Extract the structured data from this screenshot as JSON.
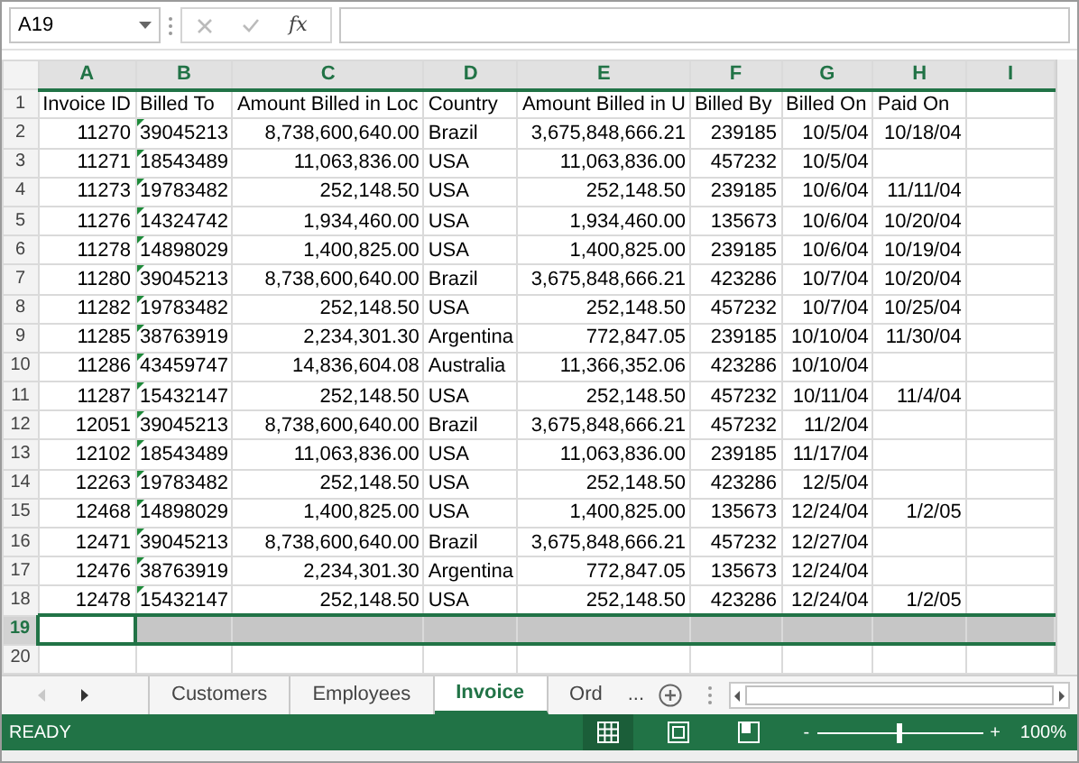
{
  "formula_bar": {
    "name_box": "A19",
    "function_label": "fx"
  },
  "columns": [
    {
      "letter": "A",
      "numeric": true,
      "selected": true
    },
    {
      "letter": "B",
      "numeric": false,
      "selected": true
    },
    {
      "letter": "C",
      "numeric": true,
      "selected": true
    },
    {
      "letter": "D",
      "numeric": false,
      "selected": true
    },
    {
      "letter": "E",
      "numeric": true,
      "selected": true
    },
    {
      "letter": "F",
      "numeric": true,
      "selected": true
    },
    {
      "letter": "G",
      "numeric": true,
      "selected": true
    },
    {
      "letter": "H",
      "numeric": true,
      "selected": true
    },
    {
      "letter": "I",
      "selected": true
    }
  ],
  "rows": [
    {
      "number": "1",
      "kind": "header",
      "selected": false,
      "number_stored_as_text": false,
      "cells": {
        "A": "Invoice ID",
        "B": "Billed To",
        "C": "Amount Billed in Loc",
        "D": "Country",
        "E": "Amount Billed in U",
        "F": "Billed By",
        "G": "Billed On",
        "H": "Paid On"
      }
    },
    {
      "number": "2",
      "kind": "data",
      "selected": false,
      "number_stored_as_text": true,
      "cells": {
        "A": "11270",
        "B": "39045213",
        "C": "8,738,600,640.00",
        "D": "Brazil",
        "E": "3,675,848,666.21",
        "F": "239185",
        "G": "10/5/04",
        "H": "10/18/04"
      }
    },
    {
      "number": "3",
      "kind": "data",
      "selected": false,
      "number_stored_as_text": true,
      "cells": {
        "A": "11271",
        "B": "18543489",
        "C": "11,063,836.00",
        "D": "USA",
        "E": "11,063,836.00",
        "F": "457232",
        "G": "10/5/04"
      }
    },
    {
      "number": "4",
      "kind": "data",
      "selected": false,
      "number_stored_as_text": true,
      "cells": {
        "A": "11273",
        "B": "19783482",
        "C": "252,148.50",
        "D": "USA",
        "E": "252,148.50",
        "F": "239185",
        "G": "10/6/04",
        "H": "11/11/04"
      }
    },
    {
      "number": "5",
      "kind": "data",
      "selected": false,
      "number_stored_as_text": true,
      "cells": {
        "A": "11276",
        "B": "14324742",
        "C": "1,934,460.00",
        "D": "USA",
        "E": "1,934,460.00",
        "F": "135673",
        "G": "10/6/04",
        "H": "10/20/04"
      }
    },
    {
      "number": "6",
      "kind": "data",
      "selected": false,
      "number_stored_as_text": true,
      "cells": {
        "A": "11278",
        "B": "14898029",
        "C": "1,400,825.00",
        "D": "USA",
        "E": "1,400,825.00",
        "F": "239185",
        "G": "10/6/04",
        "H": "10/19/04"
      }
    },
    {
      "number": "7",
      "kind": "data",
      "selected": false,
      "number_stored_as_text": true,
      "cells": {
        "A": "11280",
        "B": "39045213",
        "C": "8,738,600,640.00",
        "D": "Brazil",
        "E": "3,675,848,666.21",
        "F": "423286",
        "G": "10/7/04",
        "H": "10/20/04"
      }
    },
    {
      "number": "8",
      "kind": "data",
      "selected": false,
      "number_stored_as_text": true,
      "cells": {
        "A": "11282",
        "B": "19783482",
        "C": "252,148.50",
        "D": "USA",
        "E": "252,148.50",
        "F": "457232",
        "G": "10/7/04",
        "H": "10/25/04"
      }
    },
    {
      "number": "9",
      "kind": "data",
      "selected": false,
      "number_stored_as_text": true,
      "cells": {
        "A": "11285",
        "B": "38763919",
        "C": "2,234,301.30",
        "D": "Argentina",
        "E": "772,847.05",
        "F": "239185",
        "G": "10/10/04",
        "H": "11/30/04"
      }
    },
    {
      "number": "10",
      "kind": "data",
      "selected": false,
      "number_stored_as_text": true,
      "cells": {
        "A": "11286",
        "B": "43459747",
        "C": "14,836,604.08",
        "D": "Australia",
        "E": "11,366,352.06",
        "F": "423286",
        "G": "10/10/04"
      }
    },
    {
      "number": "11",
      "kind": "data",
      "selected": false,
      "number_stored_as_text": true,
      "cells": {
        "A": "11287",
        "B": "15432147",
        "C": "252,148.50",
        "D": "USA",
        "E": "252,148.50",
        "F": "457232",
        "G": "10/11/04",
        "H": "11/4/04"
      }
    },
    {
      "number": "12",
      "kind": "data",
      "selected": false,
      "number_stored_as_text": true,
      "cells": {
        "A": "12051",
        "B": "39045213",
        "C": "8,738,600,640.00",
        "D": "Brazil",
        "E": "3,675,848,666.21",
        "F": "457232",
        "G": "11/2/04"
      }
    },
    {
      "number": "13",
      "kind": "data",
      "selected": false,
      "number_stored_as_text": true,
      "cells": {
        "A": "12102",
        "B": "18543489",
        "C": "11,063,836.00",
        "D": "USA",
        "E": "11,063,836.00",
        "F": "239185",
        "G": "11/17/04"
      }
    },
    {
      "number": "14",
      "kind": "data",
      "selected": false,
      "number_stored_as_text": true,
      "cells": {
        "A": "12263",
        "B": "19783482",
        "C": "252,148.50",
        "D": "USA",
        "E": "252,148.50",
        "F": "423286",
        "G": "12/5/04"
      }
    },
    {
      "number": "15",
      "kind": "data",
      "selected": false,
      "number_stored_as_text": true,
      "cells": {
        "A": "12468",
        "B": "14898029",
        "C": "1,400,825.00",
        "D": "USA",
        "E": "1,400,825.00",
        "F": "135673",
        "G": "12/24/04",
        "H": "1/2/05"
      }
    },
    {
      "number": "16",
      "kind": "data",
      "selected": false,
      "number_stored_as_text": true,
      "cells": {
        "A": "12471",
        "B": "39045213",
        "C": "8,738,600,640.00",
        "D": "Brazil",
        "E": "3,675,848,666.21",
        "F": "457232",
        "G": "12/27/04"
      }
    },
    {
      "number": "17",
      "kind": "data",
      "selected": false,
      "number_stored_as_text": true,
      "cells": {
        "A": "12476",
        "B": "38763919",
        "C": "2,234,301.30",
        "D": "Argentina",
        "E": "772,847.05",
        "F": "135673",
        "G": "12/24/04"
      }
    },
    {
      "number": "18",
      "kind": "data",
      "selected": false,
      "number_stored_as_text": true,
      "cells": {
        "A": "12478",
        "B": "15432147",
        "C": "252,148.50",
        "D": "USA",
        "E": "252,148.50",
        "F": "423286",
        "G": "12/24/04",
        "H": "1/2/05"
      }
    },
    {
      "number": "19",
      "kind": "data",
      "selected": true,
      "number_stored_as_text": false,
      "cells": {}
    },
    {
      "number": "20",
      "kind": "data",
      "selected": false,
      "number_stored_as_text": false,
      "cells": {}
    }
  ],
  "sheet_tabs": [
    {
      "label": "Customers",
      "selected": false
    },
    {
      "label": "Employees",
      "selected": false
    },
    {
      "label": "Invoice",
      "selected": true
    },
    {
      "label": "Ord",
      "selected": false
    }
  ],
  "more_tabs": "...",
  "status_bar": {
    "status": "READY",
    "zoom": {
      "level": 0.5,
      "reading": "100%",
      "minus": "-",
      "plus": "+"
    },
    "views": [
      {
        "kind": "normal",
        "selected": true
      },
      {
        "kind": "page_layout",
        "selected": false
      },
      {
        "kind": "page_break",
        "selected": false
      }
    ]
  }
}
